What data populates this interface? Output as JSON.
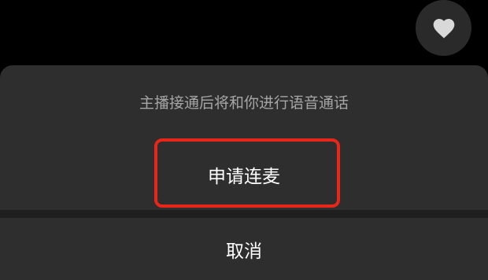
{
  "like_button": {
    "icon": "heart-icon"
  },
  "sheet": {
    "hint": "主播接通后将和你进行语音通话",
    "apply_label": "申请连麦",
    "cancel_label": "取消"
  },
  "colors": {
    "background": "#000000",
    "sheet": "#2e2e2e",
    "hint_text": "#a6a6a6",
    "button_text": "#ffffff",
    "highlight": "#e8261a"
  }
}
